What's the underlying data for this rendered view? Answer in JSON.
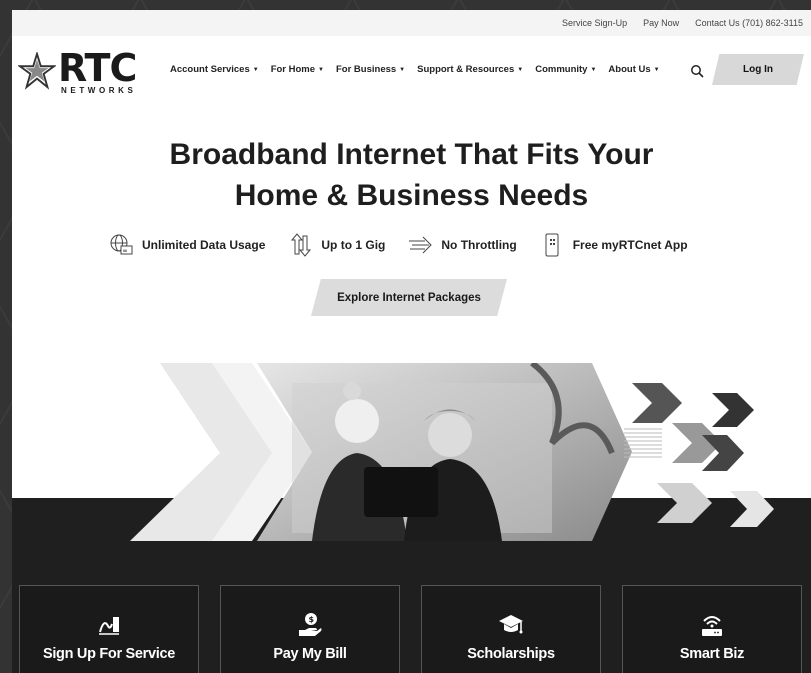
{
  "utility": {
    "sign_up": "Service Sign-Up",
    "pay_now": "Pay Now",
    "contact": "Contact Us (701) 862-3115"
  },
  "logo": {
    "name": "RTC",
    "sub": "NETWORKS"
  },
  "nav": {
    "items": [
      {
        "label": "Account Services"
      },
      {
        "label": "For Home"
      },
      {
        "label": "For Business"
      },
      {
        "label": "Support & Resources"
      },
      {
        "label": "Community"
      },
      {
        "label": "About Us"
      }
    ],
    "login": "Log In",
    "search_icon": "search-icon"
  },
  "hero": {
    "title_line1": "Broadband Internet That Fits Your",
    "title_line2": "Home & Business Needs",
    "cta": "Explore Internet Packages"
  },
  "features": [
    {
      "label": "Unlimited Data Usage",
      "icon": "globe-icon"
    },
    {
      "label": "Up to 1 Gig",
      "icon": "speed-arrows-icon"
    },
    {
      "label": "No Throttling",
      "icon": "fast-arrows-icon"
    },
    {
      "label": "Free myRTCnet App",
      "icon": "phone-app-icon"
    }
  ],
  "cards": [
    {
      "label": "Sign Up For Service",
      "icon": "signature-icon"
    },
    {
      "label": "Pay My Bill",
      "icon": "hand-coin-icon"
    },
    {
      "label": "Scholarships",
      "icon": "graduation-cap-icon"
    },
    {
      "label": "Smart Biz",
      "icon": "wifi-router-icon"
    }
  ],
  "colors": {
    "dark": "#1f1f1f",
    "button_bg": "#dcdcdc",
    "text": "#1e1e1e"
  }
}
